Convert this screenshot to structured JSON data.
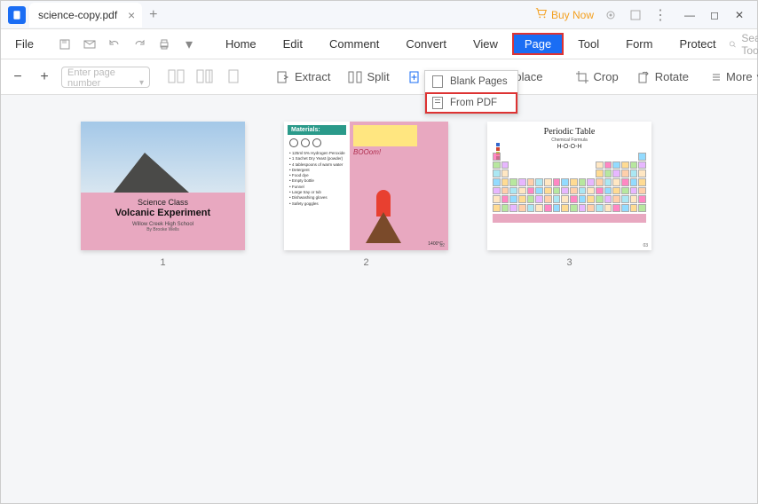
{
  "titlebar": {
    "tab_title": "science-copy.pdf",
    "buy_now": "Buy Now"
  },
  "menubar": {
    "file": "File",
    "items": [
      "Home",
      "Edit",
      "Comment",
      "Convert",
      "View",
      "Page",
      "Tool",
      "Form",
      "Protect"
    ],
    "active_index": 5,
    "search_placeholder": "Search Tools"
  },
  "toolbar": {
    "page_placeholder": "Enter page number",
    "extract": "Extract",
    "split": "Split",
    "insert": "Insert",
    "replace": "Replace",
    "crop": "Crop",
    "rotate": "Rotate",
    "more": "More"
  },
  "dropdown": {
    "blank": "Blank Pages",
    "from_pdf": "From PDF"
  },
  "thumbs": {
    "p1": {
      "title1": "Science Class",
      "title2": "Volcanic Experiment",
      "sub1": "Willow Creek High School",
      "sub2": "By Brooke Wells",
      "num": "1"
    },
    "p2": {
      "materials": "Materials:",
      "list": "• 125ml 5% Hydrogen Peroxide\n• 1 Sachet Dry Yeast (powder)\n• 4 tablespoons of warm water\n• Detergent\n• Food dye\n• Empty bottle\n• Funnel\n• Large tray or tub\n• Dishwashing gloves\n• Safety goggles",
      "boom": "BOOom!",
      "temp": "1400°C",
      "pg": "02",
      "num": "2"
    },
    "p3": {
      "title": "Periodic Table",
      "sub": "Chemical Formula",
      "formula": "H-O-O-H",
      "pg": "03",
      "num": "3"
    }
  },
  "colors": {
    "accent": "#1a6df4",
    "highlight_border": "#d33",
    "pink": "#e8a8c0"
  }
}
